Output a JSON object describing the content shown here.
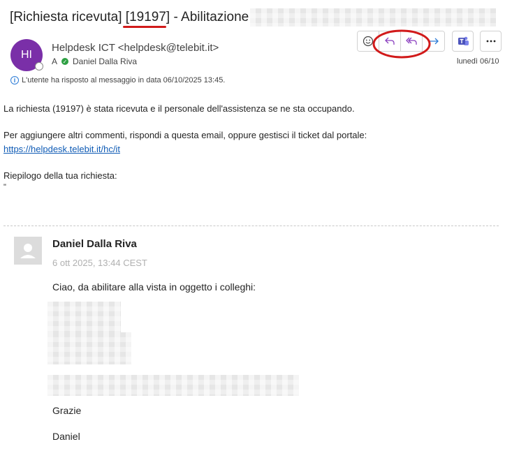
{
  "subject": {
    "prefix": "[Richiesta ricevuta] ",
    "ticket": "[19197]",
    "suffix": " - Abilitazione"
  },
  "sender": {
    "avatar_initials": "HI",
    "display": "Helpdesk ICT <helpdesk@telebit.it>",
    "to_label": "A",
    "recipient": "Daniel Dalla Riva",
    "date": "lunedì 06/10"
  },
  "toolbar": {
    "emoji_icon": "smiley-icon",
    "reply_icon": "reply-icon",
    "reply_all_icon": "reply-all-icon",
    "forward_icon": "forward-icon",
    "teams_icon": "teams-icon",
    "more_icon": "more-icon"
  },
  "info_bar": "L'utente ha risposto al messaggio in data 06/10/2025 13:45.",
  "body": {
    "line1": "La richiesta (19197) è stata ricevuta e il personale dell'assistenza se ne sta occupando.",
    "line2": "Per aggiungere altri commenti, rispondi a questa email, oppure gestisci il ticket dal portale:",
    "link": "https://helpdesk.telebit.it/hc/it",
    "line3": "Riepilogo della tua richiesta:",
    "quote_mark": "\""
  },
  "quoted": {
    "author": "Daniel Dalla Riva",
    "date": "6 ott 2025, 13:44 CEST",
    "greeting": "Ciao, da abilitare alla vista in oggetto i colleghi:",
    "thanks": "Grazie",
    "signature": "Daniel"
  },
  "colors": {
    "accent": "#7a2fa8",
    "annotation_red": "#d11a1a",
    "link": "#0f5bb5",
    "reply_purple": "#8a3fbf"
  }
}
